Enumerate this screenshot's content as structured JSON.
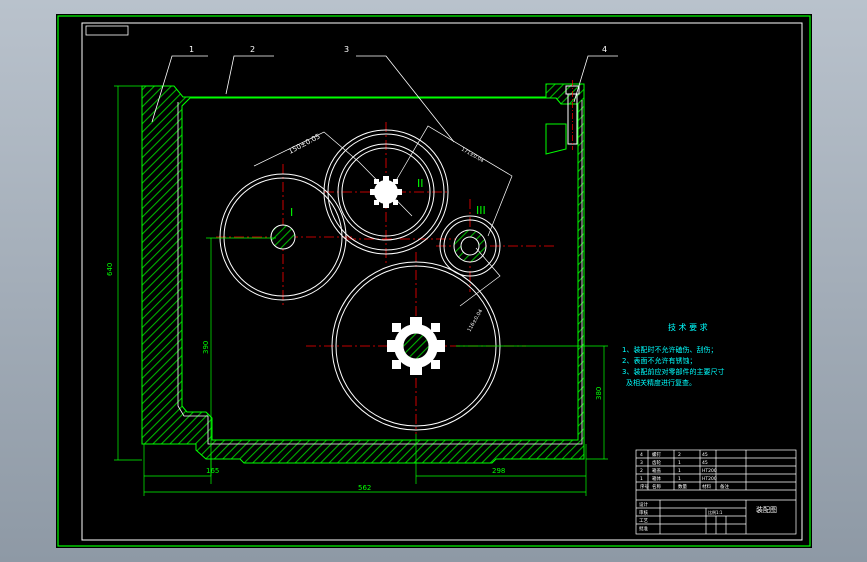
{
  "drawing": {
    "balloons": [
      "1",
      "2",
      "3",
      "4"
    ],
    "shaft_labels": [
      "I",
      "II",
      "III"
    ],
    "dimensions": {
      "overall_height": "640",
      "bottom_left": "165",
      "bottom_right": "298",
      "overall_width": "562",
      "right_height": "380",
      "mid_height": "390",
      "center_dist_top": "150±0.05",
      "center_dist_right": "171±0.04",
      "center_dist_small": "116±0.04"
    },
    "tech_requirements": {
      "title": "技 术 要 求",
      "items": [
        "1、装配时不允许磕伤、刮伤；",
        "2、表面不允许有锈蚀；",
        "3、装配前应对零部件的主要尺寸",
        "及相关精度进行复查。"
      ]
    },
    "title_block": {
      "drawing_name": "装配图",
      "rows": [
        [
          "4",
          "螺钉",
          "2",
          "45",
          ""
        ],
        [
          "3",
          "齿轮",
          "1",
          "45",
          ""
        ],
        [
          "2",
          "箱盖",
          "1",
          "HT200",
          ""
        ],
        [
          "1",
          "箱体",
          "1",
          "HT200",
          ""
        ]
      ],
      "header": [
        "序号",
        "名称",
        "数量",
        "材料",
        "备注"
      ],
      "sign_labels": [
        "设计",
        "审核",
        "工艺",
        "批准"
      ],
      "scale_label": "比例1:1"
    }
  },
  "colors": {
    "housing": "#00ff00",
    "gear_lines": "#ffffff",
    "center_lines": "#ff0000",
    "text": "#00ffff",
    "frame": "#ffffff",
    "balloon": "#ffffff"
  }
}
